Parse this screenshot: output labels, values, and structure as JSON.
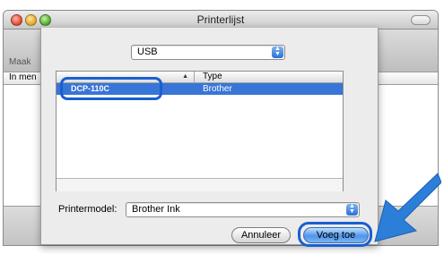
{
  "window": {
    "title": "Printerlijst",
    "toolbar_label": "Maak",
    "list_header": "In men"
  },
  "sheet": {
    "connection_popup": {
      "value": "USB"
    },
    "table": {
      "columns": [
        "",
        "Type"
      ],
      "rows": [
        {
          "name": "DCP-110C",
          "type": "Brother",
          "selected": true
        }
      ]
    },
    "printer_model": {
      "label": "Printermodel:",
      "value": "Brother Ink"
    },
    "buttons": {
      "cancel_label": "Annuleer",
      "add_label": "Voeg toe"
    }
  },
  "colors": {
    "selection": "#3875d7",
    "highlight_outline": "#1a5fd0",
    "pointer_arrow": "#2b7fd9"
  }
}
